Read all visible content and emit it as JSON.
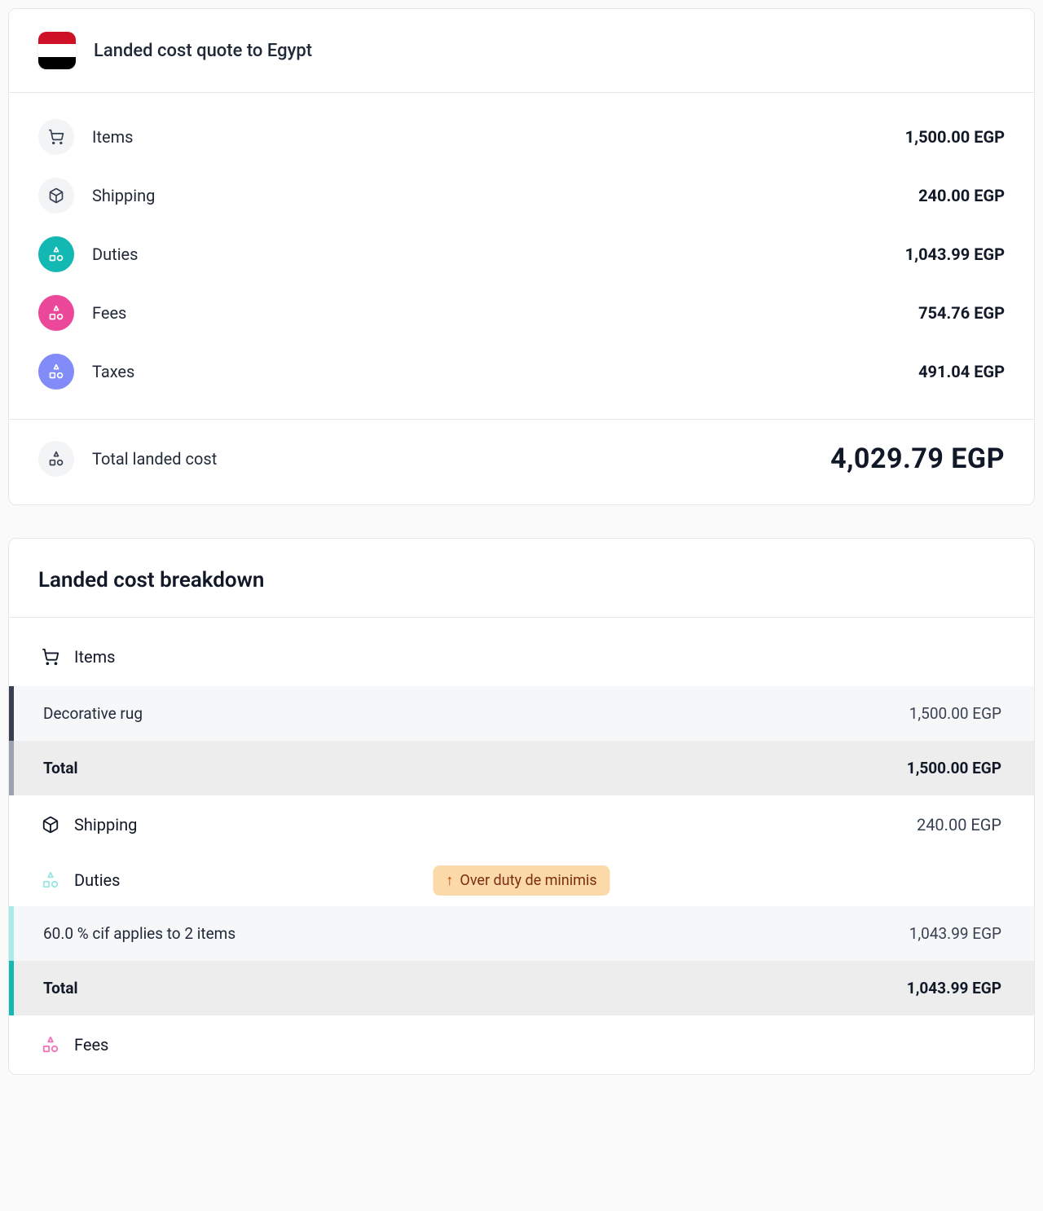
{
  "quote": {
    "title": "Landed cost quote to Egypt",
    "country_flag": "egypt",
    "summary": {
      "items": {
        "label": "Items",
        "value": "1,500.00 EGP"
      },
      "shipping": {
        "label": "Shipping",
        "value": "240.00 EGP"
      },
      "duties": {
        "label": "Duties",
        "value": "1,043.99 EGP"
      },
      "fees": {
        "label": "Fees",
        "value": "754.76 EGP"
      },
      "taxes": {
        "label": "Taxes",
        "value": "491.04 EGP"
      }
    },
    "total": {
      "label": "Total landed cost",
      "value": "4,029.79 EGP"
    }
  },
  "breakdown": {
    "title": "Landed cost breakdown",
    "items_section": {
      "label": "Items",
      "rows": [
        {
          "label": "Decorative rug",
          "value": "1,500.00 EGP"
        }
      ],
      "total": {
        "label": "Total",
        "value": "1,500.00 EGP"
      }
    },
    "shipping_section": {
      "label": "Shipping",
      "value": "240.00 EGP"
    },
    "duties_section": {
      "label": "Duties",
      "badge": "Over duty de minimis",
      "rows": [
        {
          "label": "60.0 % cif applies to 2 items",
          "value": "1,043.99 EGP"
        }
      ],
      "total": {
        "label": "Total",
        "value": "1,043.99 EGP"
      }
    },
    "fees_section": {
      "label": "Fees"
    }
  }
}
